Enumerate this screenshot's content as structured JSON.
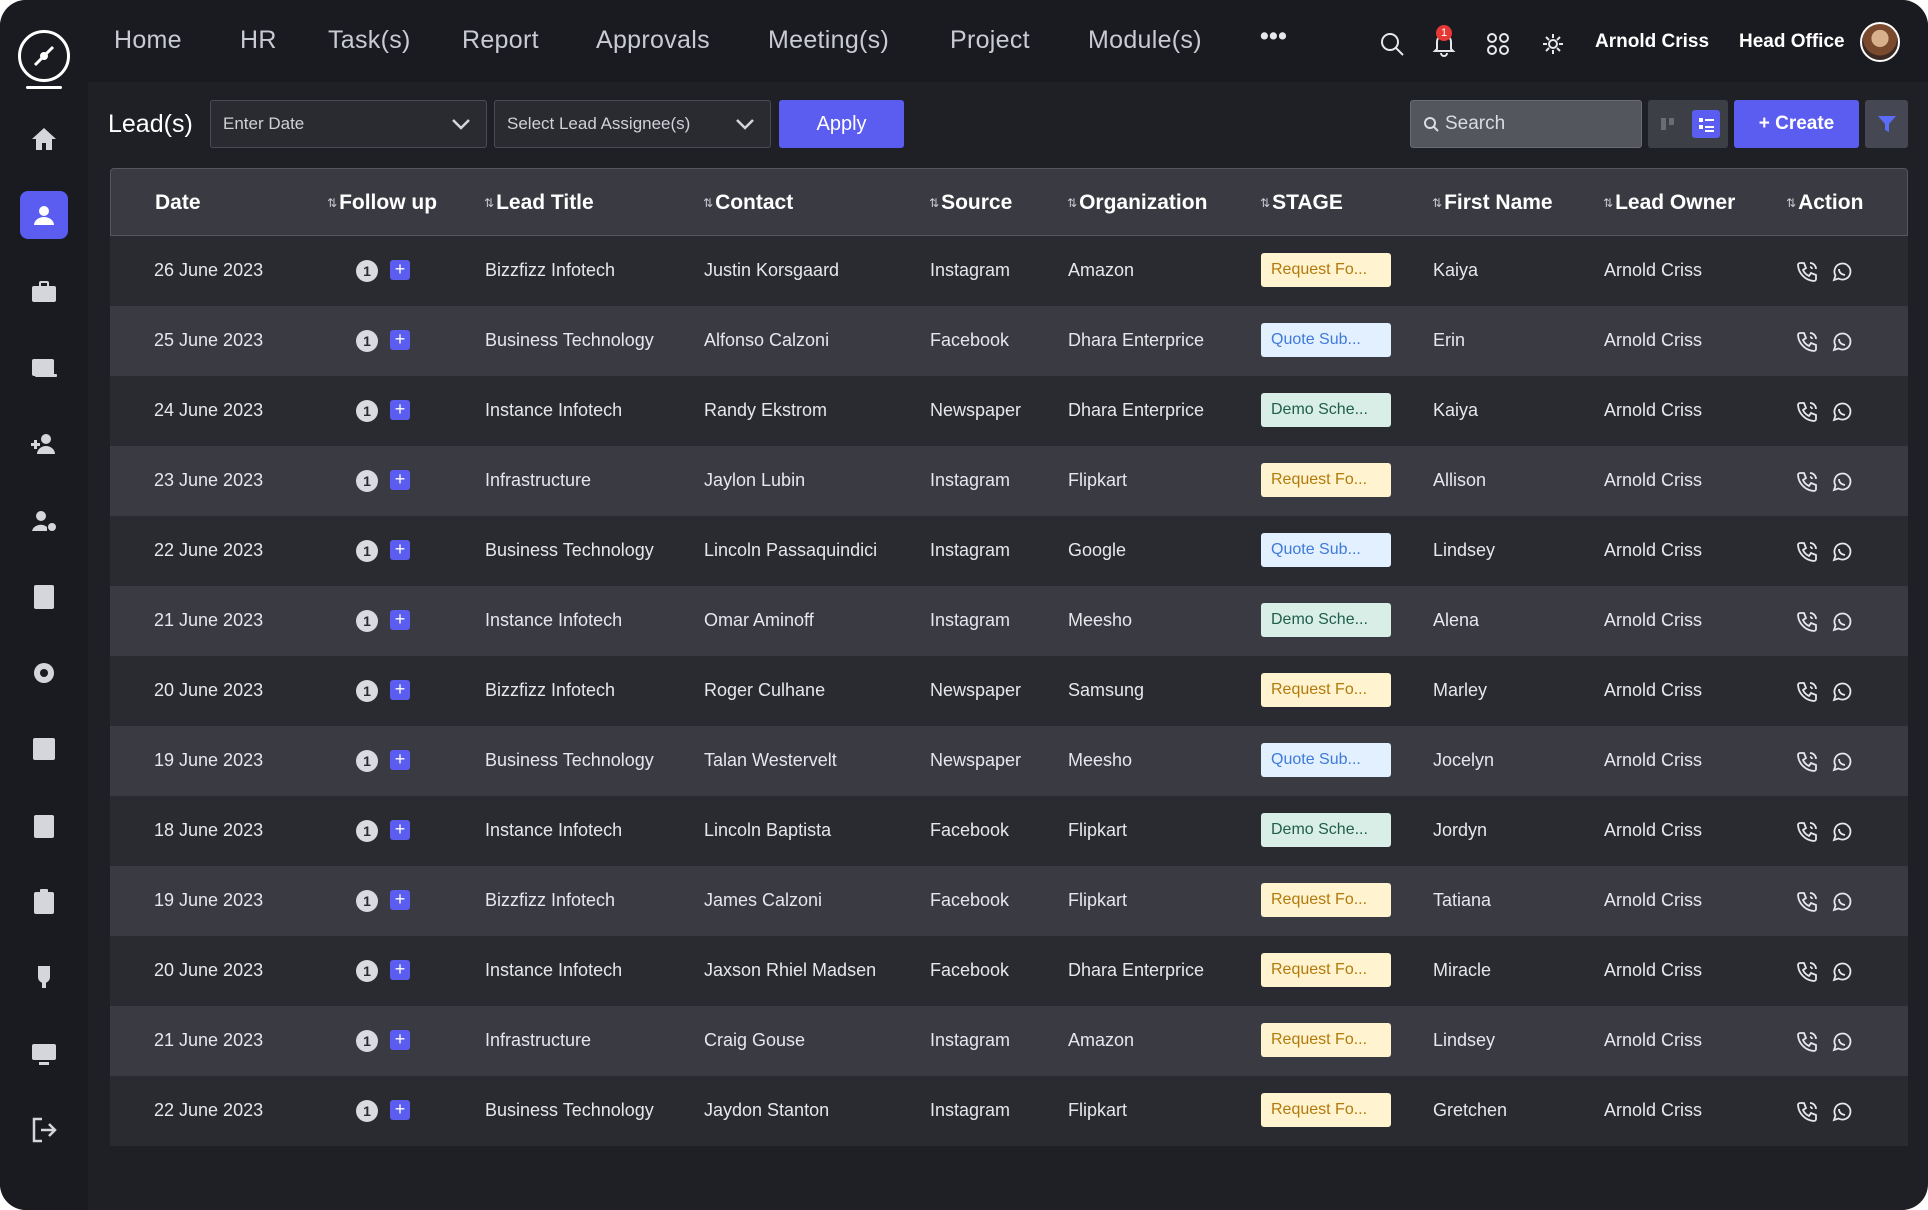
{
  "nav": {
    "items": [
      "Home",
      "HR",
      "Task(s)",
      "Report",
      "Approvals",
      "Meeting(s)",
      "Project",
      "Module(s)"
    ],
    "more": "•••",
    "notification_count": "1",
    "user_name": "Arnold Criss",
    "office": "Head Office"
  },
  "sidebar": {
    "icons": [
      "home-icon",
      "user-card-icon",
      "briefcase-icon",
      "id-card-icon",
      "add-user-icon",
      "user-gear-icon",
      "calculator-icon",
      "gear-icon",
      "chart-icon",
      "badge-icon",
      "clipboard-icon",
      "trophy-icon",
      "monitor-icon",
      "logout-icon"
    ],
    "active": "user-card-icon"
  },
  "toolbar": {
    "title": "Lead(s)",
    "date_placeholder": "Enter Date",
    "assignee_placeholder": "Select Lead Assignee(s)",
    "apply_label": "Apply",
    "search_placeholder": "Search",
    "create_label": "+ Create"
  },
  "table": {
    "headers": [
      "Date",
      "Follow up",
      "Lead Title",
      "Contact",
      "Source",
      "Organization",
      "STAGE",
      "First Name",
      "Lead Owner",
      "Action"
    ],
    "rows": [
      {
        "date": "26 June 2023",
        "follow": "1",
        "title": "Bizzfizz Infotech",
        "contact": "Justin Korsgaard",
        "source": "Instagram",
        "org": "Amazon",
        "stage": "Request Fo...",
        "stage_type": "req",
        "first": "Kaiya",
        "owner": "Arnold Criss"
      },
      {
        "date": "25 June 2023",
        "follow": "1",
        "title": "Business Technology",
        "contact": "Alfonso Calzoni",
        "source": "Facebook",
        "org": "Dhara Enterprice",
        "stage": "Quote Sub...",
        "stage_type": "quote",
        "first": "Erin",
        "owner": "Arnold Criss"
      },
      {
        "date": "24 June 2023",
        "follow": "1",
        "title": "Instance Infotech",
        "contact": "Randy Ekstrom",
        "source": "Newspaper",
        "org": "Dhara Enterprice",
        "stage": "Demo Sche...",
        "stage_type": "demo",
        "first": "Kaiya",
        "owner": "Arnold Criss"
      },
      {
        "date": "23 June 2023",
        "follow": "1",
        "title": "Infrastructure",
        "contact": "Jaylon Lubin",
        "source": "Instagram",
        "org": "Flipkart",
        "stage": "Request Fo...",
        "stage_type": "req",
        "first": "Allison",
        "owner": "Arnold Criss"
      },
      {
        "date": "22 June 2023",
        "follow": "1",
        "title": "Business Technology",
        "contact": "Lincoln Passaquindici",
        "source": "Instagram",
        "org": "Google",
        "stage": "Quote Sub...",
        "stage_type": "quote",
        "first": "Lindsey",
        "owner": "Arnold Criss"
      },
      {
        "date": "21 June 2023",
        "follow": "1",
        "title": "Instance Infotech",
        "contact": "Omar Aminoff",
        "source": "Instagram",
        "org": "Meesho",
        "stage": "Demo Sche...",
        "stage_type": "demo",
        "first": "Alena",
        "owner": "Arnold Criss"
      },
      {
        "date": "20 June 2023",
        "follow": "1",
        "title": "Bizzfizz Infotech",
        "contact": "Roger Culhane",
        "source": "Newspaper",
        "org": "Samsung",
        "stage": "Request Fo...",
        "stage_type": "req",
        "first": "Marley",
        "owner": "Arnold Criss"
      },
      {
        "date": "19 June 2023",
        "follow": "1",
        "title": "Business Technology",
        "contact": "Talan Westervelt",
        "source": "Newspaper",
        "org": "Meesho",
        "stage": "Quote Sub...",
        "stage_type": "quote",
        "first": "Jocelyn",
        "owner": "Arnold Criss"
      },
      {
        "date": "18 June 2023",
        "follow": "1",
        "title": "Instance Infotech",
        "contact": "Lincoln Baptista",
        "source": "Facebook",
        "org": "Flipkart",
        "stage": "Demo Sche...",
        "stage_type": "demo",
        "first": "Jordyn",
        "owner": "Arnold Criss"
      },
      {
        "date": "19 June 2023",
        "follow": "1",
        "title": "Bizzfizz Infotech",
        "contact": "James Calzoni",
        "source": "Facebook",
        "org": "Flipkart",
        "stage": "Request Fo...",
        "stage_type": "req",
        "first": "Tatiana",
        "owner": "Arnold Criss"
      },
      {
        "date": "20 June 2023",
        "follow": "1",
        "title": "Instance Infotech",
        "contact": "Jaxson Rhiel Madsen",
        "source": "Facebook",
        "org": "Dhara Enterprice",
        "stage": "Request Fo...",
        "stage_type": "req",
        "first": "Miracle",
        "owner": "Arnold Criss"
      },
      {
        "date": "21 June 2023",
        "follow": "1",
        "title": "Infrastructure",
        "contact": "Craig Gouse",
        "source": "Instagram",
        "org": "Amazon",
        "stage": "Request Fo...",
        "stage_type": "req",
        "first": "Lindsey",
        "owner": "Arnold Criss"
      },
      {
        "date": "22 June 2023",
        "follow": "1",
        "title": "Business Technology",
        "contact": "Jaydon Stanton",
        "source": "Instagram",
        "org": "Flipkart",
        "stage": "Request Fo...",
        "stage_type": "req",
        "first": "Gretchen",
        "owner": "Arnold Criss"
      }
    ]
  },
  "colors": {
    "accent": "#5b5cf0",
    "background": "#1f2026",
    "row_dark": "#2a2b31",
    "row_light": "#3a3b42"
  }
}
